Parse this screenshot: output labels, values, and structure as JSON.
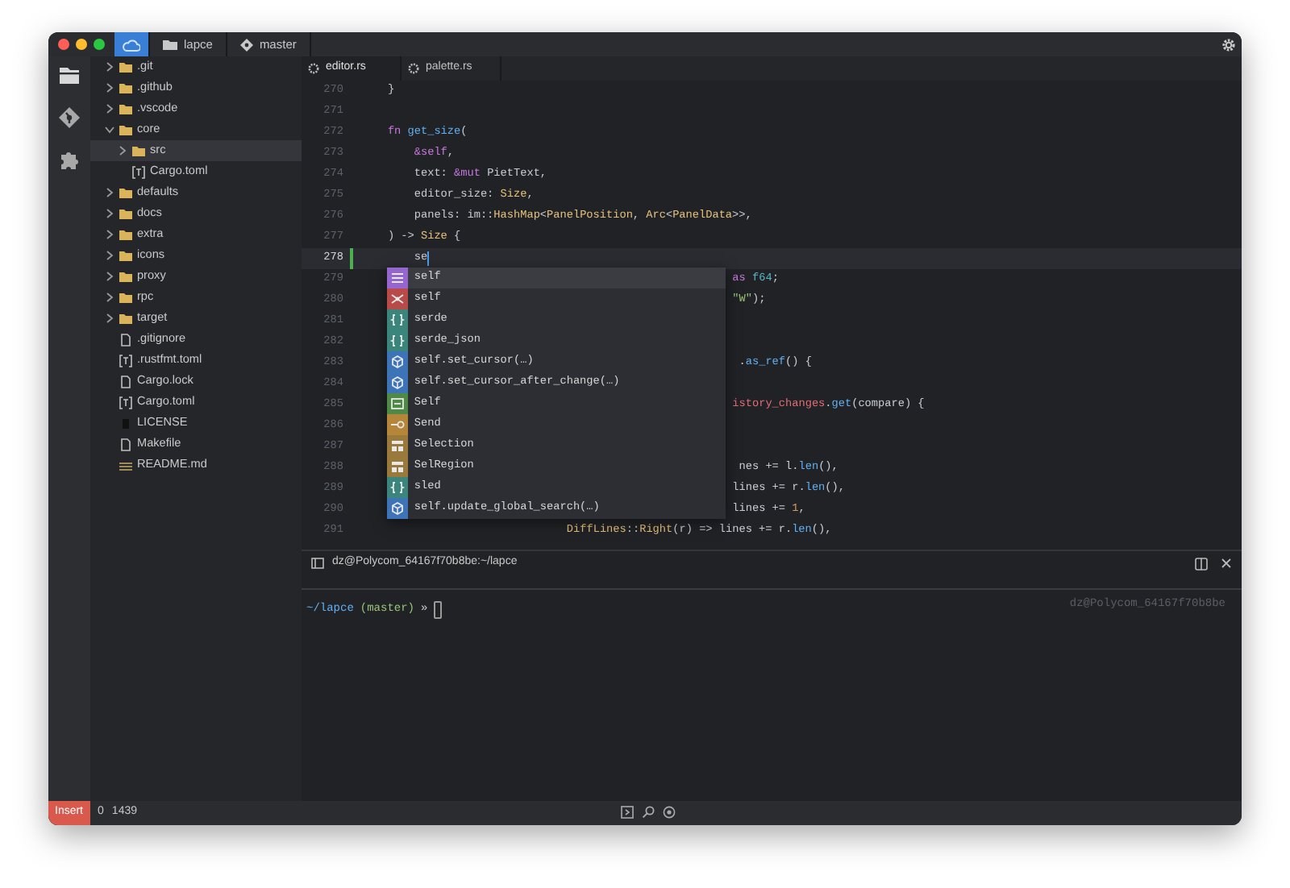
{
  "title_bar": {
    "project": "lapce",
    "branch": "master"
  },
  "activity_bar": [
    {
      "kind": "explorer",
      "selected": true
    },
    {
      "kind": "source-control",
      "selected": false
    },
    {
      "kind": "plugins",
      "selected": false
    }
  ],
  "file_tree": [
    {
      "label": ".git",
      "kind": "folder",
      "expanded": false,
      "selected": false
    },
    {
      "label": ".github",
      "kind": "folder",
      "expanded": false,
      "selected": false
    },
    {
      "label": ".vscode",
      "kind": "folder",
      "expanded": false,
      "selected": false
    },
    {
      "label": "core",
      "kind": "folder",
      "expanded": true,
      "selected": false,
      "children": [
        {
          "label": "src",
          "kind": "folder",
          "expanded": false,
          "selected": true
        },
        {
          "label": "Cargo.toml",
          "kind": "toml",
          "selected": false
        }
      ]
    },
    {
      "label": "defaults",
      "kind": "folder",
      "expanded": false,
      "selected": false
    },
    {
      "label": "docs",
      "kind": "folder",
      "expanded": false,
      "selected": false
    },
    {
      "label": "extra",
      "kind": "folder",
      "expanded": false,
      "selected": false
    },
    {
      "label": "icons",
      "kind": "folder",
      "expanded": false,
      "selected": false
    },
    {
      "label": "proxy",
      "kind": "folder",
      "expanded": false,
      "selected": false
    },
    {
      "label": "rpc",
      "kind": "folder",
      "expanded": false,
      "selected": false
    },
    {
      "label": "target",
      "kind": "folder",
      "expanded": false,
      "selected": false
    },
    {
      "label": ".gitignore",
      "kind": "file",
      "selected": false
    },
    {
      "label": ".rustfmt.toml",
      "kind": "toml",
      "selected": false
    },
    {
      "label": "Cargo.lock",
      "kind": "file",
      "selected": false
    },
    {
      "label": "Cargo.toml",
      "kind": "toml",
      "selected": false
    },
    {
      "label": "LICENSE",
      "kind": "license",
      "selected": false
    },
    {
      "label": "Makefile",
      "kind": "file",
      "selected": false
    },
    {
      "label": "README.md",
      "kind": "markdown",
      "selected": false
    }
  ],
  "tabs": [
    {
      "label": "editor.rs",
      "selected": true
    },
    {
      "label": "palette.rs",
      "selected": false
    }
  ],
  "editor": {
    "lines": [
      {
        "number": "270",
        "current": false,
        "modified": false,
        "tokens": [
          {
            "text": "    }",
            "kind": "plain"
          }
        ]
      },
      {
        "number": "271",
        "current": false,
        "modified": false
      },
      {
        "number": "272",
        "current": false,
        "modified": false,
        "tokens": [
          {
            "text": "    fn ",
            "kind": "keyword"
          },
          {
            "text": "get_size",
            "kind": "function"
          },
          {
            "text": "(",
            "kind": "plain"
          }
        ]
      },
      {
        "number": "273",
        "current": false,
        "modified": false,
        "tokens": [
          {
            "text": "        &self",
            "kind": "keyword"
          },
          {
            "text": ",",
            "kind": "plain"
          }
        ]
      },
      {
        "number": "274",
        "current": false,
        "modified": false,
        "tokens": [
          {
            "text": "        text: ",
            "kind": "plain"
          },
          {
            "text": "&mut",
            "kind": "keyword"
          },
          {
            "text": " PietText,",
            "kind": "plain"
          }
        ]
      },
      {
        "number": "275",
        "current": false,
        "modified": false,
        "tokens": [
          {
            "text": "        editor_size: ",
            "kind": "plain"
          },
          {
            "text": "Size",
            "kind": "type"
          },
          {
            "text": ",",
            "kind": "plain"
          }
        ]
      },
      {
        "number": "276",
        "current": false,
        "modified": false,
        "tokens": [
          {
            "text": "        panels: im::",
            "kind": "plain"
          },
          {
            "text": "HashMap",
            "kind": "type"
          },
          {
            "text": "<",
            "kind": "plain"
          },
          {
            "text": "PanelPosition",
            "kind": "type"
          },
          {
            "text": ", ",
            "kind": "plain"
          },
          {
            "text": "Arc",
            "kind": "type"
          },
          {
            "text": "<",
            "kind": "plain"
          },
          {
            "text": "PanelData",
            "kind": "type"
          },
          {
            "text": ">>,",
            "kind": "plain"
          }
        ]
      },
      {
        "number": "277",
        "current": false,
        "modified": false,
        "tokens": [
          {
            "text": "    ) -> ",
            "kind": "plain"
          },
          {
            "text": "Size",
            "kind": "type"
          },
          {
            "text": " {",
            "kind": "plain"
          }
        ]
      },
      {
        "number": "278",
        "current": true,
        "modified": true,
        "tokens": [
          {
            "text": "        se",
            "kind": "plain"
          }
        ]
      },
      {
        "number": "279",
        "current": false,
        "modified": false,
        "tokens": [
          {
            "text": "                                                        as",
            "kind": "keyword"
          },
          {
            "text": " f64",
            "kind": "builtin"
          },
          {
            "text": ";",
            "kind": "plain"
          }
        ]
      },
      {
        "number": "280",
        "current": false,
        "modified": false,
        "tokens": [
          {
            "text": "                                                        \"W\"",
            "kind": "string"
          },
          {
            "text": ");",
            "kind": "plain"
          }
        ]
      },
      {
        "number": "281",
        "current": false,
        "modified": false
      },
      {
        "number": "282",
        "current": false,
        "modified": false
      },
      {
        "number": "283",
        "current": false,
        "modified": false,
        "tokens": [
          {
            "text": "                                                         .",
            "kind": "plain"
          },
          {
            "text": "as_ref",
            "kind": "function"
          },
          {
            "text": "() {",
            "kind": "plain"
          }
        ]
      },
      {
        "number": "284",
        "current": false,
        "modified": false
      },
      {
        "number": "285",
        "current": false,
        "modified": false,
        "tokens": [
          {
            "text": "                                                        istory_changes",
            "kind": "variable"
          },
          {
            "text": ".",
            "kind": "plain"
          },
          {
            "text": "get",
            "kind": "function"
          },
          {
            "text": "(compare) {",
            "kind": "plain"
          }
        ]
      },
      {
        "number": "286",
        "current": false,
        "modified": false
      },
      {
        "number": "287",
        "current": false,
        "modified": false
      },
      {
        "number": "288",
        "current": false,
        "modified": false,
        "tokens": [
          {
            "text": "                                                         nes += l.",
            "kind": "plain"
          },
          {
            "text": "len",
            "kind": "function"
          },
          {
            "text": "(),",
            "kind": "plain"
          }
        ]
      },
      {
        "number": "289",
        "current": false,
        "modified": false,
        "tokens": [
          {
            "text": "                                                        lines += r.",
            "kind": "plain"
          },
          {
            "text": "len",
            "kind": "function"
          },
          {
            "text": "(),",
            "kind": "plain"
          }
        ]
      },
      {
        "number": "290",
        "current": false,
        "modified": false,
        "tokens": [
          {
            "text": "                                                        lines += ",
            "kind": "plain"
          },
          {
            "text": "1",
            "kind": "number"
          },
          {
            "text": ",",
            "kind": "plain"
          }
        ]
      },
      {
        "number": "291",
        "current": false,
        "modified": false,
        "tokens": [
          {
            "text": "                               DiffLines",
            "kind": "type"
          },
          {
            "text": "::",
            "kind": "plain"
          },
          {
            "text": "Right",
            "kind": "type"
          },
          {
            "text": "(r) => lines += r.",
            "kind": "plain"
          },
          {
            "text": "len",
            "kind": "function"
          },
          {
            "text": "(),",
            "kind": "plain"
          }
        ]
      }
    ],
    "completion": {
      "items": [
        {
          "label": "self",
          "kind": "keyword",
          "color": "#9565d0",
          "selected": true
        },
        {
          "label": "self",
          "kind": "snippet",
          "color": "#b84a4a",
          "selected": false
        },
        {
          "label": "serde",
          "kind": "module",
          "color": "#3a857c",
          "selected": false
        },
        {
          "label": "serde_json",
          "kind": "module",
          "color": "#3a857c",
          "selected": false
        },
        {
          "label": "self.set_cursor(…)",
          "kind": "method",
          "color": "#3d74b8",
          "selected": false
        },
        {
          "label": "self.set_cursor_after_change(…)",
          "kind": "method",
          "color": "#3d74b8",
          "selected": false
        },
        {
          "label": "Self",
          "kind": "struct",
          "color": "#4e8a45",
          "selected": false
        },
        {
          "label": "Send",
          "kind": "interface",
          "color": "#b5853a",
          "selected": false
        },
        {
          "label": "Selection",
          "kind": "class",
          "color": "#9a7a3a",
          "selected": false
        },
        {
          "label": "SelRegion",
          "kind": "class",
          "color": "#9a7a3a",
          "selected": false
        },
        {
          "label": "sled",
          "kind": "module",
          "color": "#3a857c",
          "selected": false
        },
        {
          "label": "self.update_global_search(…)",
          "kind": "method",
          "color": "#3d74b8",
          "selected": false
        }
      ]
    }
  },
  "terminal": {
    "title": "dz@Polycom_64167f70b8be:~/lapce",
    "prompt": [
      {
        "text": "~/lapce",
        "kind": "path"
      },
      {
        "text": "(master)",
        "kind": "branch"
      },
      {
        "text": "»",
        "kind": "plain"
      }
    ],
    "hint": "dz@Polycom_64167f70b8be"
  },
  "status_bar": {
    "mode": "Insert",
    "errors": "0",
    "warnings": "1439"
  }
}
